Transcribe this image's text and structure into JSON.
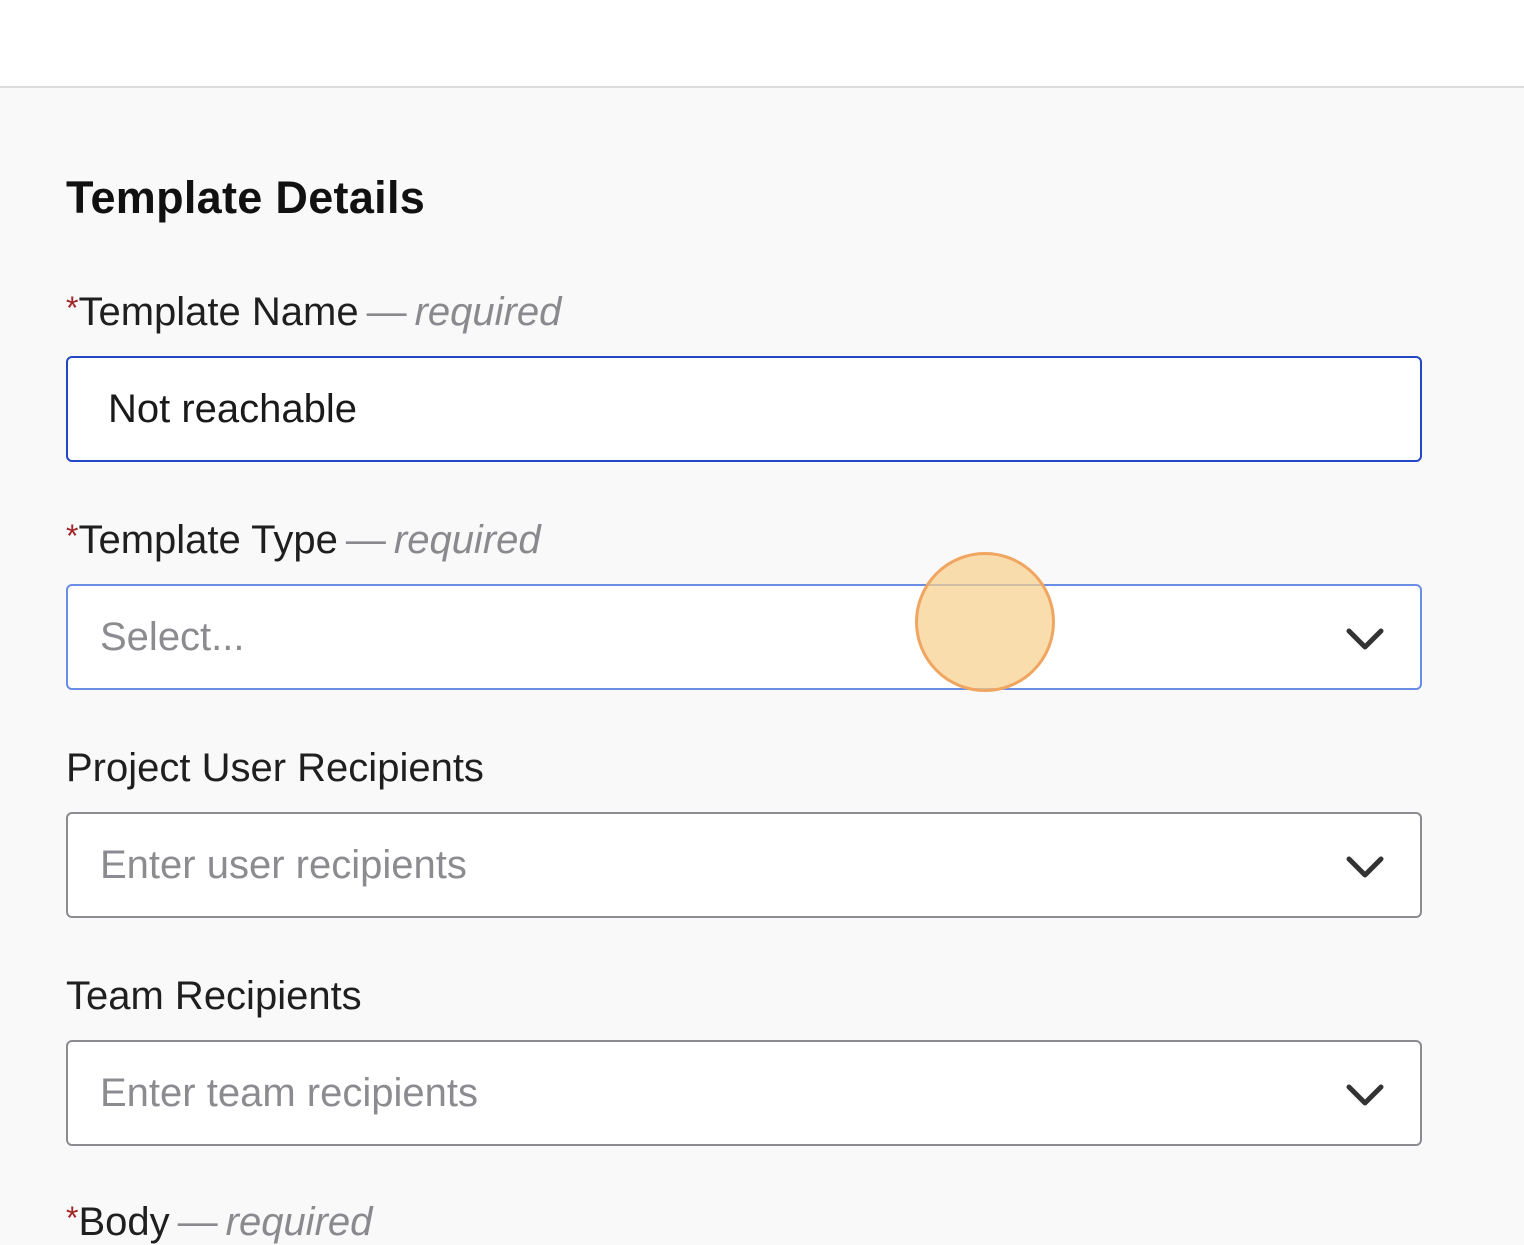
{
  "form": {
    "section_title": "Template Details",
    "template_name": {
      "label": "Template Name",
      "required_note": "required",
      "value": "Not reachable"
    },
    "template_type": {
      "label": "Template Type",
      "required_note": "required",
      "placeholder": "Select..."
    },
    "project_user_recipients": {
      "label": "Project User Recipients",
      "placeholder": "Enter user recipients"
    },
    "team_recipients": {
      "label": "Team Recipients",
      "placeholder": "Enter team recipients"
    },
    "body": {
      "label": "Body",
      "required_note": "required"
    },
    "required_marker": "*",
    "dash": "—"
  },
  "icons": {
    "dropdown": "chevron-down-icon"
  },
  "colors": {
    "focus_border": "#2446c7",
    "required_star": "#a02828",
    "cursor_highlight": "#f8d08c"
  }
}
